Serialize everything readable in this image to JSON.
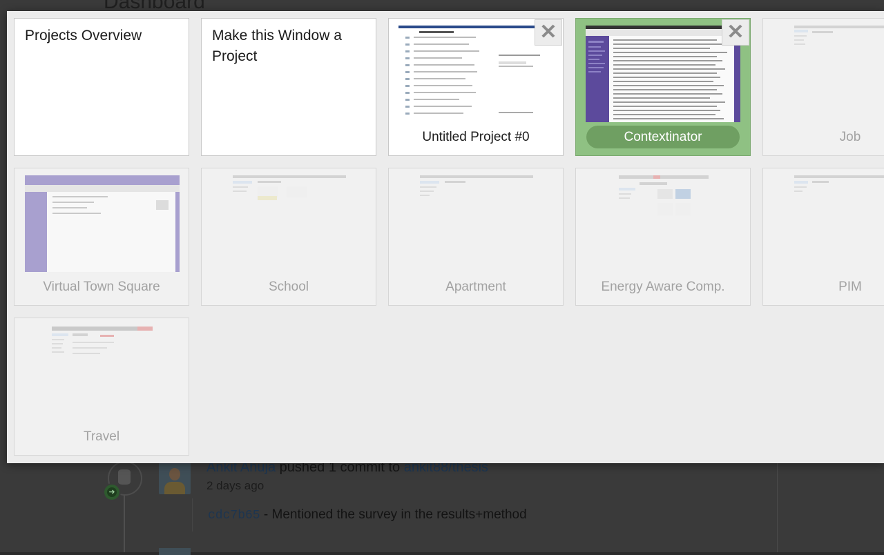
{
  "background": {
    "page_title": "Dashboard",
    "event": {
      "user": "Ankit Ahuja",
      "action": "pushed 1 commit to",
      "repo": "ankit88/thesis",
      "time": "2 days ago"
    },
    "commit": {
      "sha": "cdc7b65",
      "message": "- Mentioned the survey in the results+method"
    }
  },
  "overlay": {
    "projects_overview_label": "Projects Overview",
    "make_project_label": "Make this Window a Project",
    "close_symbol": "✕",
    "projects": [
      {
        "label": "Untitled Project #0"
      },
      {
        "label": "Contextinator"
      },
      {
        "label": "Job"
      },
      {
        "label": "Virtual Town Square"
      },
      {
        "label": "School"
      },
      {
        "label": "Apartment"
      },
      {
        "label": "Energy Aware Comp."
      },
      {
        "label": "PIM"
      },
      {
        "label": "Travel"
      }
    ]
  },
  "colors": {
    "current_tile": "#8fc183",
    "current_pill": "#6f9f62",
    "tile_bg": "#f1f1f1",
    "overlay_bg": "#ececec"
  }
}
